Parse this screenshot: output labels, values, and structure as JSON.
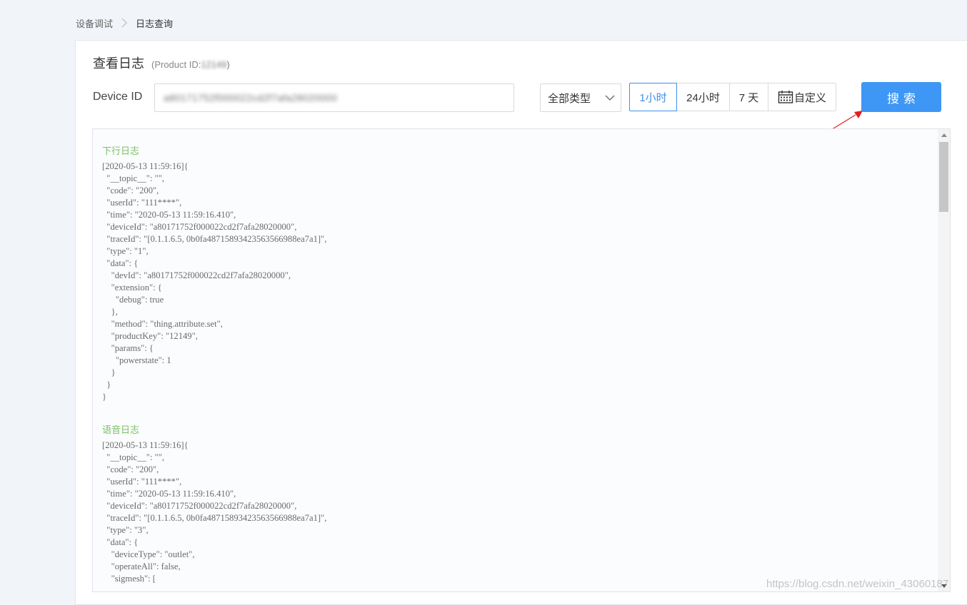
{
  "breadcrumb": {
    "parent": "设备调试",
    "current": "日志查询"
  },
  "page": {
    "title": "查看日志",
    "product_id_prefix": "(Product ID: ",
    "product_id_value": "12149",
    "product_id_suffix": ")"
  },
  "filters": {
    "device_id_label": "Device ID",
    "device_id_value": "a80171752f000022cd2f7afa28020000",
    "type_select": "全部类型",
    "time_ranges": [
      {
        "label": "1小时",
        "active": true
      },
      {
        "label": "24小时",
        "active": false
      },
      {
        "label": "7 天",
        "active": false
      },
      {
        "label": "自定义",
        "active": false,
        "icon": "calendar-icon"
      }
    ],
    "search_label": "搜索"
  },
  "logs": [
    {
      "heading": "下行日志",
      "lines": [
        "[2020-05-13 11:59:16]{",
        "  \"__topic__\": \"\",",
        "  \"code\": \"200\",",
        "  \"userId\": \"111****\",",
        "  \"time\": \"2020-05-13 11:59:16.410\",",
        "  \"deviceId\": \"a80171752f000022cd2f7afa28020000\",",
        "  \"traceId\": \"[0.1.1.6.5, 0b0fa48715893423563566988ea7a1]\",",
        "  \"type\": \"1\",",
        "  \"data\": {",
        "    \"devId\": \"a80171752f000022cd2f7afa28020000\",",
        "    \"extension\": {",
        "      \"debug\": true",
        "    },",
        "    \"method\": \"thing.attribute.set\",",
        "    \"productKey\": \"12149\",",
        "    \"params\": {",
        "      \"powerstate\": 1",
        "    }",
        "  }",
        "}"
      ]
    },
    {
      "heading": "语音日志",
      "lines": [
        "[2020-05-13 11:59:16]{",
        "  \"__topic__\": \"\",",
        "  \"code\": \"200\",",
        "  \"userId\": \"111****\",",
        "  \"time\": \"2020-05-13 11:59:16.410\",",
        "  \"deviceId\": \"a80171752f000022cd2f7afa28020000\",",
        "  \"traceId\": \"[0.1.1.6.5, 0b0fa48715893423563566988ea7a1]\",",
        "  \"type\": \"3\",",
        "  \"data\": {",
        "    \"deviceType\": \"outlet\",",
        "    \"operateAll\": false,",
        "    \"sigmesh\": ["
      ]
    }
  ],
  "watermark": "https://blog.csdn.net/weixin_43060187",
  "colors": {
    "accent": "#3e97f5",
    "log_heading": "#7bbf62",
    "arrow": "#e02020"
  }
}
